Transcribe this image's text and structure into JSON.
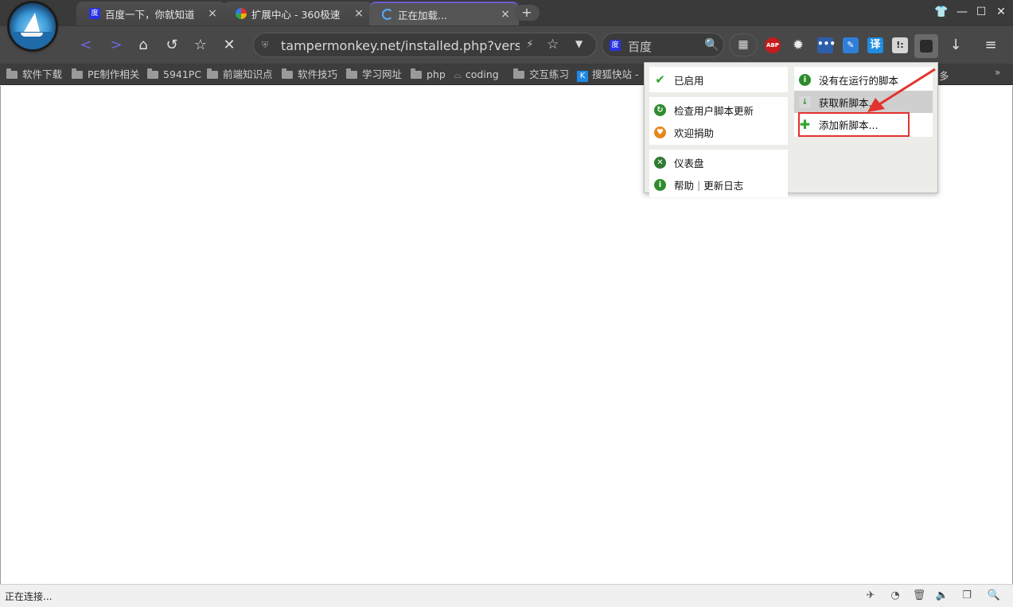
{
  "tabs": [
    {
      "title": "百度一下，你就知道",
      "close": "×"
    },
    {
      "title": "扩展中心 - 360极速",
      "close": "×"
    },
    {
      "title": "正在加载...",
      "close": "×"
    }
  ],
  "new_tab_label": "+",
  "window_buttons": {
    "skin": "👕",
    "minimize": "—",
    "maximize": "☐",
    "close": "✕"
  },
  "nav": {
    "back": "<",
    "forward": ">",
    "home": "⌂",
    "undo": "↺",
    "favorite": "☆",
    "stop": "✕"
  },
  "address": {
    "url": "tampermonkey.net/installed.php?version=",
    "bolt": "⚡",
    "favorite": "☆",
    "dropdown": "▼"
  },
  "search": {
    "engine_icon": "度",
    "placeholder": "百度",
    "go": "🔍"
  },
  "apps_button": "▦",
  "extensions": {
    "abp": "ABP",
    "gear": "✹",
    "dots": "•••",
    "edit": "✎",
    "translate": "译",
    "tm": "!:"
  },
  "download_btn": "↓",
  "menu_btn": "≡",
  "bookmarks": [
    "软件下载",
    "PE制作相关",
    "5941PC",
    "前端知识点",
    "软件技巧",
    "学习网址",
    "php",
    "coding",
    "交互练习",
    "搜狐快站 -"
  ],
  "bookmarks_more": "多",
  "bookmarks_chevron": "»",
  "popup": {
    "left_groups": [
      [
        {
          "icon": "check-icon",
          "label": "已启用"
        }
      ],
      [
        {
          "icon": "refresh-icon",
          "label": "检查用户脚本更新"
        },
        {
          "icon": "donate-icon",
          "label": "欢迎捐助"
        }
      ],
      [
        {
          "icon": "dashboard-icon",
          "label": "仪表盘"
        },
        {
          "icon": "info-icon",
          "label": "帮助",
          "extra": "更新日志"
        }
      ]
    ],
    "right_items": [
      {
        "icon": "info-icon",
        "label": "没有在运行的脚本"
      },
      {
        "icon": "download-icon",
        "label": "获取新脚本..."
      },
      {
        "icon": "plus-icon",
        "label": "添加新脚本..."
      }
    ],
    "separator": "|"
  },
  "status": {
    "text": "正在连接..."
  },
  "accent_colors": {
    "annotation": "#e2332f",
    "active_tab": "#6b5bd6",
    "popup_bg": "#ecece9"
  }
}
